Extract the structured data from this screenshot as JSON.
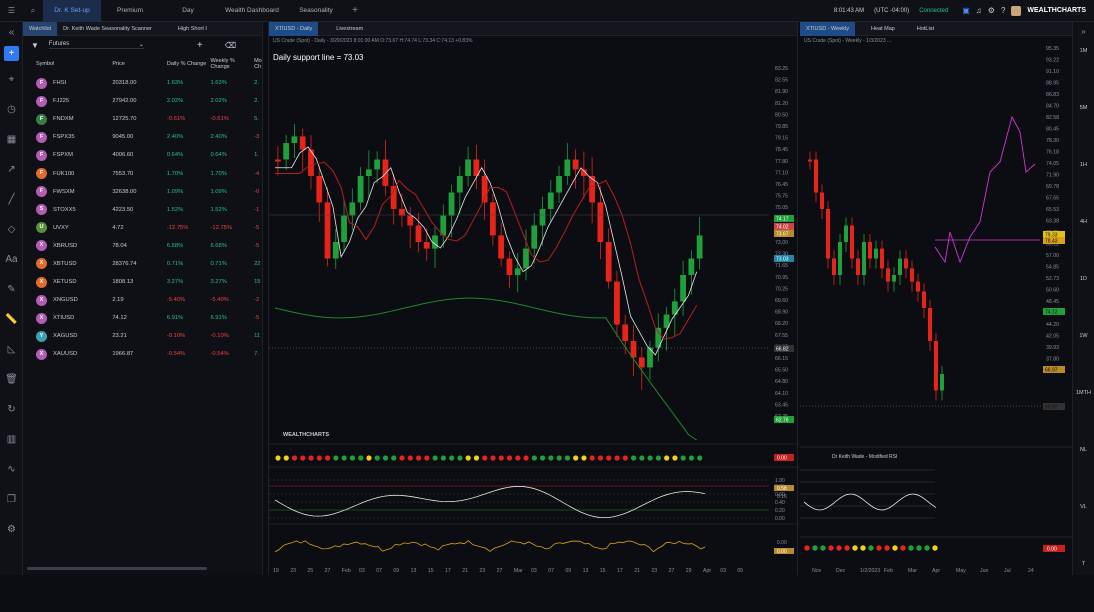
{
  "topbar": {
    "tabs": [
      "Dr. K Set-up",
      "Premium",
      "Day",
      "Wealth Dashboard",
      "Seasonality"
    ],
    "time": "8:01:43 AM",
    "tz": "(UTC -04:00)",
    "status": "Connected",
    "brand": "WEALTHCHARTS"
  },
  "watch": {
    "tabs": [
      "Watchlist",
      "Dr. Keith Wade Seasonality Scanner",
      "High Short I"
    ],
    "filter": "Futures",
    "headers": [
      "Symbol",
      "Price",
      "Daily % Change",
      "Weekly % Change",
      "Mo Ch"
    ],
    "rows": [
      {
        "l": "F",
        "s": "FHSI",
        "p": "20318.00",
        "d": "1.63%",
        "w": "1.63%",
        "m": "2.",
        "c": "#b45bb3"
      },
      {
        "l": "F",
        "s": "FJ225",
        "p": "27942.00",
        "d": "2.02%",
        "w": "2.02%",
        "m": "2.",
        "c": "#b45bb3"
      },
      {
        "l": "F",
        "s": "FNDXM",
        "p": "12725.70",
        "d": "-0.61%",
        "w": "-0.61%",
        "m": "5.",
        "c": "#3a7d44"
      },
      {
        "l": "F",
        "s": "FSPX35",
        "p": "9045.00",
        "d": "2.40%",
        "w": "2.40%",
        "m": "-3",
        "c": "#b45bb3"
      },
      {
        "l": "F",
        "s": "FSPXM",
        "p": "4006.60",
        "d": "0.64%",
        "w": "0.64%",
        "m": "1.",
        "c": "#b45bb3"
      },
      {
        "l": "F",
        "s": "FUK100",
        "p": "7553.70",
        "d": "1.70%",
        "w": "1.70%",
        "m": "-4",
        "c": "#e46a2b"
      },
      {
        "l": "F",
        "s": "FWSXM",
        "p": "32638.00",
        "d": "1.09%",
        "w": "1.09%",
        "m": "-0",
        "c": "#b45bb3"
      },
      {
        "l": "S",
        "s": "STOXX5",
        "p": "4223.50",
        "d": "1.52%",
        "w": "1.52%",
        "m": "-1",
        "c": "#b45bb3"
      },
      {
        "l": "U",
        "s": "UVXY",
        "p": "4.72",
        "d": "-12.75%",
        "w": "-12.75%",
        "m": "-5",
        "c": "#5a8f3a"
      },
      {
        "l": "X",
        "s": "XBRUSD",
        "p": "78.04",
        "d": "6.68%",
        "w": "6.68%",
        "m": "-5",
        "c": "#b45bb3"
      },
      {
        "l": "X",
        "s": "XBTUSD",
        "p": "28376.74",
        "d": "0.71%",
        "w": "0.71%",
        "m": "22",
        "c": "#e46a2b"
      },
      {
        "l": "X",
        "s": "XETUSD",
        "p": "1808.13",
        "d": "3.27%",
        "w": "3.27%",
        "m": "15",
        "c": "#e46a2b"
      },
      {
        "l": "X",
        "s": "XNGUSD",
        "p": "2.19",
        "d": "-5.40%",
        "w": "-5.40%",
        "m": "-2",
        "c": "#b45bb3"
      },
      {
        "l": "X",
        "s": "XTIUSD",
        "p": "74.12",
        "d": "6.91%",
        "w": "6.91%",
        "m": "-5",
        "c": "#b45bb3"
      },
      {
        "l": "Y",
        "s": "XAGUSD",
        "p": "23.21",
        "d": "-0.10%",
        "w": "-0.10%",
        "m": "11",
        "c": "#3aa0b5"
      },
      {
        "l": "X",
        "s": "XAUUSD",
        "p": "1966.87",
        "d": "-0.54%",
        "w": "-0.54%",
        "m": "7.",
        "c": "#b45bb3"
      }
    ]
  },
  "panelA": {
    "tabs": [
      "XTIUSD - Daily",
      "Livestream"
    ],
    "info": "US Crude (Spot) - Daily - 3/29/2023 8:01:00 AM O:73.67 H:74.74 L:73.34 C:74.13 +0.83%",
    "note": "Daily support line = 73.03",
    "yticks": [
      "83.25",
      "82.55",
      "81.90",
      "81.20",
      "80.50",
      "79.85",
      "79.15",
      "78.45",
      "77.80",
      "77.10",
      "76.45",
      "75.75",
      "75.05",
      "74.35",
      "73.70",
      "73.00",
      "72.30",
      "71.65",
      "70.95",
      "70.25",
      "69.60",
      "68.90",
      "68.20",
      "67.55",
      "66.85",
      "66.15",
      "65.50",
      "64.80",
      "64.10",
      "63.45",
      "62.75"
    ],
    "xticks": [
      "19",
      "23",
      "25",
      "27",
      "Feb",
      "03",
      "07",
      "09",
      "13",
      "15",
      "17",
      "21",
      "23",
      "27",
      "Mar",
      "03",
      "07",
      "09",
      "13",
      "15",
      "17",
      "21",
      "23",
      "27",
      "29",
      "Apr",
      "03",
      "05"
    ],
    "labels": {
      "price": "74.17",
      "r1": "74.02",
      "r2": "73.67",
      "blue": "73.03",
      "cross": "66.82",
      "green": "62.76"
    },
    "brand": "WEALTHCHARTS",
    "ind1": "0.00",
    "ind2a": "0.58",
    "ind2b": "0.16",
    "ind3": "0.00",
    "ind3b": "0.00",
    "ind2ticks": [
      "1.00",
      "0.80",
      "0.60",
      "0.40",
      "0.20",
      "0.00"
    ]
  },
  "panelB": {
    "tabs": [
      "XTIUSD - Weekly",
      "Heat Map",
      "HotList"
    ],
    "info": "US Crude (Spot) - Weekly - 1/3/2023 ...",
    "yticks": [
      "95.35",
      "93.22",
      "91.10",
      "88.95",
      "86.83",
      "84.70",
      "82.58",
      "80.45",
      "78.30",
      "76.18",
      "74.05",
      "71.90",
      "69.78",
      "67.65",
      "65.53",
      "63.38",
      "61.25",
      "59.12",
      "57.00",
      "54.85",
      "52.73",
      "50.60",
      "48.45",
      "46.33",
      "44.20",
      "42.05",
      "39.93",
      "37.80"
    ],
    "xticks": [
      "Nov",
      "Dec",
      "1/2/2023",
      "Feb",
      "Mar",
      "Apr",
      "May",
      "Jun",
      "Jul",
      "24"
    ],
    "labels": {
      "p1": "79.33",
      "p2": "78.43",
      "g": "74.12",
      "o": "66.97",
      "cross": "66.82"
    },
    "study": "Dr Keith Wade - Modified RSI",
    "ind": "0.00"
  },
  "rightbar": {
    "tf": [
      "1M",
      "5M",
      "1H",
      "4H",
      "1D",
      "1W",
      "1MTH",
      "NL",
      "VL",
      "T"
    ]
  }
}
